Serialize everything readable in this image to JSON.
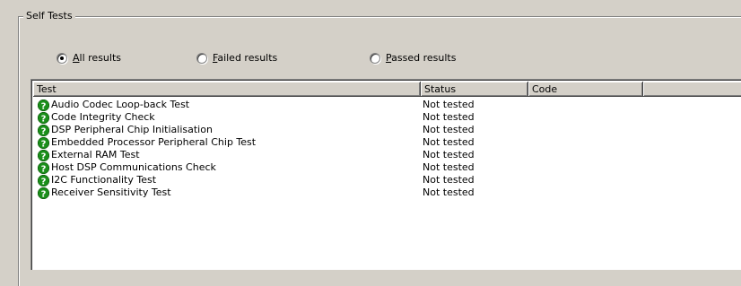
{
  "group": {
    "title": "Self Tests"
  },
  "filters": {
    "all": {
      "label_accel": "A",
      "label_rest": "ll results",
      "checked": true
    },
    "failed": {
      "label_accel": "F",
      "label_rest": "ailed results",
      "checked": false
    },
    "passed": {
      "label_accel": "P",
      "label_rest": "assed results",
      "checked": false
    }
  },
  "table": {
    "columns": [
      "Test",
      "Status",
      "Code",
      ""
    ],
    "rows": [
      {
        "name": "Audio Codec Loop-back Test",
        "status": "Not tested",
        "code": "",
        "icon": "question-icon"
      },
      {
        "name": "Code Integrity Check",
        "status": "Not tested",
        "code": "",
        "icon": "question-icon"
      },
      {
        "name": "DSP Peripheral Chip Initialisation",
        "status": "Not tested",
        "code": "",
        "icon": "question-icon"
      },
      {
        "name": "Embedded Processor Peripheral Chip Test",
        "status": "Not tested",
        "code": "",
        "icon": "question-icon"
      },
      {
        "name": "External RAM Test",
        "status": "Not tested",
        "code": "",
        "icon": "question-icon"
      },
      {
        "name": "Host DSP Communications Check",
        "status": "Not tested",
        "code": "",
        "icon": "question-icon"
      },
      {
        "name": "I2C Functionality Test",
        "status": "Not tested",
        "code": "",
        "icon": "question-icon"
      },
      {
        "name": "Receiver Sensitivity Test",
        "status": "Not tested",
        "code": "",
        "icon": "question-icon"
      }
    ]
  },
  "colors": {
    "icon_green": "#1a8f1a",
    "window_bg": "#d4d0c8"
  }
}
